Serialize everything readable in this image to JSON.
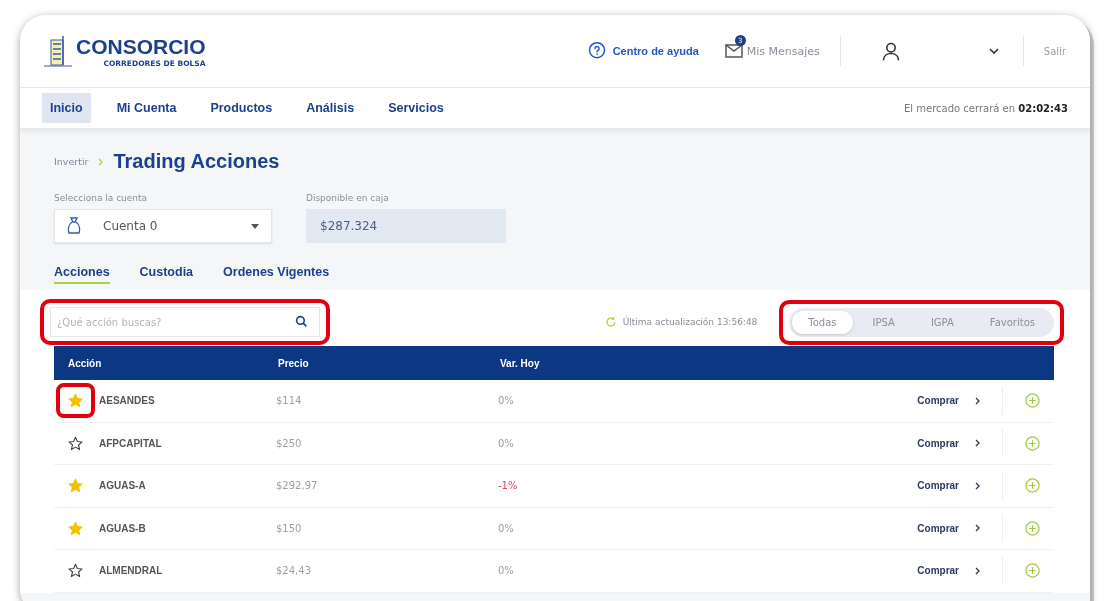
{
  "header": {
    "logo_title": "CONSORCIO",
    "logo_subtitle": "CORREDORES DE BOLSA",
    "help": "Centro de ayuda",
    "messages": {
      "label": "Mis Mensajes",
      "count": "3"
    },
    "logout": "Salir"
  },
  "nav": {
    "items": [
      {
        "label": "Inicio",
        "selected": true
      },
      {
        "label": "Mi Cuenta",
        "selected": false
      },
      {
        "label": "Productos",
        "selected": false
      },
      {
        "label": "Análisis",
        "selected": false
      },
      {
        "label": "Servicios",
        "selected": false
      }
    ],
    "market_prefix": "El mercado cerrará en",
    "market_time": "02:02:43"
  },
  "breadcrumb": {
    "parent": "Invertir",
    "title": "Trading Acciones"
  },
  "account": {
    "label": "Selecciona la cuenta",
    "value": "Cuenta 0"
  },
  "cash": {
    "label": "Disponible en caja",
    "value": "$287.324"
  },
  "tabs": [
    {
      "label": "Acciones",
      "selected": true
    },
    {
      "label": "Custodia",
      "selected": false
    },
    {
      "label": "Ordenes Vigentes",
      "selected": false
    }
  ],
  "search": {
    "placeholder": "¿Qué acción buscas?",
    "highlighted": true
  },
  "last_update": "Última actualización 13:56:48",
  "filters": {
    "highlighted": true,
    "items": [
      {
        "label": "Todas",
        "selected": true
      },
      {
        "label": "IPSA",
        "selected": false
      },
      {
        "label": "IGPA",
        "selected": false
      },
      {
        "label": "Favoritos",
        "selected": false
      }
    ]
  },
  "table": {
    "columns": [
      "Acción",
      "Precio",
      "Var. Hoy"
    ],
    "rows": [
      {
        "favorite": true,
        "star_highlighted": true,
        "name": "AESANDES",
        "price": "$114",
        "change": "0%",
        "negative": false,
        "action": "Comprar"
      },
      {
        "favorite": false,
        "star_highlighted": false,
        "name": "AFPCAPITAL",
        "price": "$250",
        "change": "0%",
        "negative": false,
        "action": "Comprar"
      },
      {
        "favorite": true,
        "star_highlighted": false,
        "name": "AGUAS-A",
        "price": "$292,97",
        "change": "-1%",
        "negative": true,
        "action": "Comprar"
      },
      {
        "favorite": true,
        "star_highlighted": false,
        "name": "AGUAS-B",
        "price": "$150",
        "change": "0%",
        "negative": false,
        "action": "Comprar"
      },
      {
        "favorite": false,
        "star_highlighted": false,
        "name": "ALMENDRAL",
        "price": "$24,43",
        "change": "0%",
        "negative": false,
        "action": "Comprar"
      }
    ]
  }
}
